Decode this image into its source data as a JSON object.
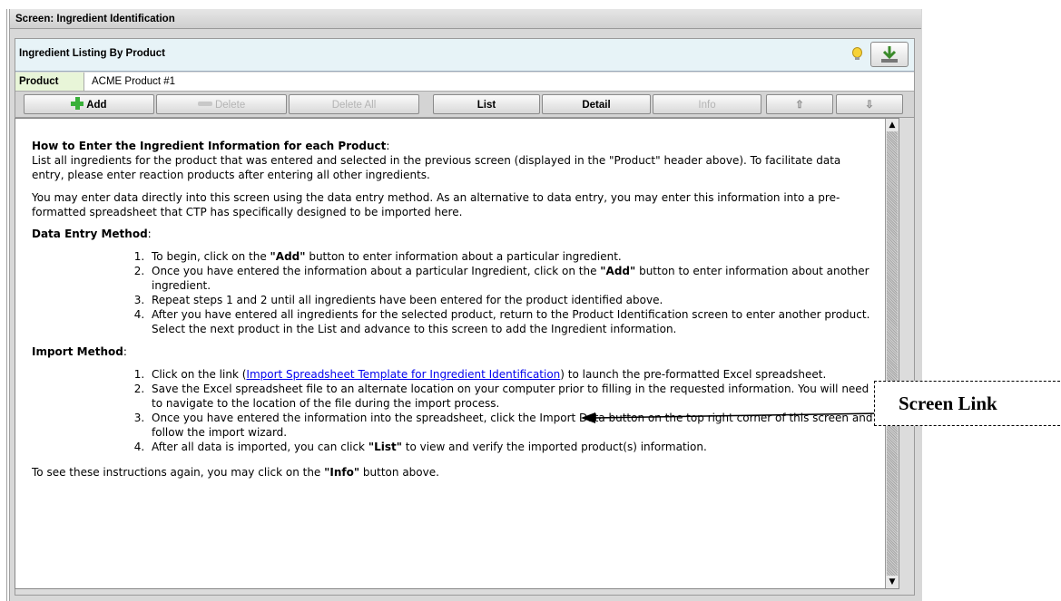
{
  "screen": {
    "title": "Screen: Ingredient Identification"
  },
  "listing": {
    "title": "Ingredient Listing By Product"
  },
  "product": {
    "label": "Product",
    "value": "ACME Product #1"
  },
  "toolbar": {
    "add": "Add",
    "delete": "Delete",
    "delete_all": "Delete All",
    "list": "List",
    "detail": "Detail",
    "info": "Info"
  },
  "instructions": {
    "heading": "How to Enter the Ingredient Information for each Product",
    "intro": "List all ingredients for the product that was entered and selected in the previous screen (displayed in the \"Product\" header above). To facilitate data entry, please enter reaction products after entering all other ingredients.",
    "alt_intro": "You may enter data directly into this screen using the data entry method. As an alternative to data entry, you may enter this information into a pre-formatted spreadsheet that CTP has specifically designed to be imported here.",
    "data_entry_heading": "Data Entry Method",
    "de1_a": "To begin, click on the ",
    "de1_b": "\"Add\"",
    "de1_c": " button to enter information about a particular ingredient.",
    "de2_a": "Once you have entered the information about a particular Ingredient, click on the ",
    "de2_b": "\"Add\"",
    "de2_c": " button to enter information about another ingredient.",
    "de3": "Repeat steps 1 and 2 until all ingredients have been entered for the product identified above.",
    "de4": "After you have entered all ingredients for the selected product, return to the Product Identification screen to enter another product. Select the next product in the List and advance to this screen to add the Ingredient information.",
    "import_heading": "Import Method",
    "im1_a": "Click on the link (",
    "im1_link": "Import Spreadsheet Template for Ingredient Identification",
    "im1_c": ") to launch the pre-formatted Excel spreadsheet.",
    "im2": "Save the Excel spreadsheet file to an alternate location on your computer prior to filling in the requested information. You will need to navigate to the location of the file during the import process.",
    "im3": "Once you have entered the information into the spreadsheet, click the Import Data button on the top right corner of this screen and follow the import wizard.",
    "im4_a": "After all data is imported, you can click ",
    "im4_b": "\"List\"",
    "im4_c": " to view and verify the imported product(s) information.",
    "footer_a": "To see these instructions again, you may click on the ",
    "footer_b": "\"Info\"",
    "footer_c": " button above."
  },
  "callout": {
    "label": "Screen Link"
  },
  "icons": {
    "bulb": "lightbulb-icon",
    "import": "import-download-icon",
    "add": "plus-icon",
    "delete": "delete-icon",
    "up": "arrow-up-icon",
    "down": "arrow-down-icon"
  }
}
